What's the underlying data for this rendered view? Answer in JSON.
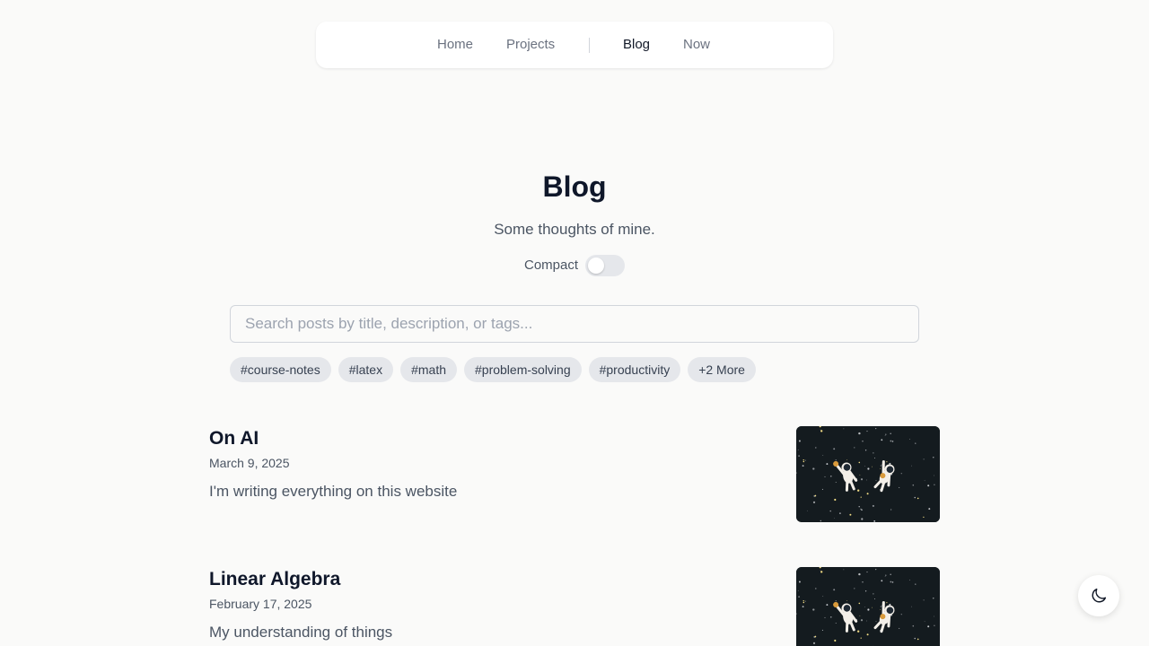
{
  "nav": {
    "items": [
      {
        "label": "Home",
        "active": false
      },
      {
        "label": "Projects",
        "active": false
      },
      {
        "label": "Blog",
        "active": true
      },
      {
        "label": "Now",
        "active": false
      }
    ]
  },
  "header": {
    "title": "Blog",
    "subtitle": "Some thoughts of mine.",
    "compact_label": "Compact",
    "compact_enabled": false
  },
  "search": {
    "value": "",
    "placeholder": "Search posts by title, description, or tags..."
  },
  "tags": [
    "#course-notes",
    "#latex",
    "#math",
    "#problem-solving",
    "#productivity",
    "+2 More"
  ],
  "posts": [
    {
      "title": "On AI",
      "date": "March 9, 2025",
      "description": "I'm writing everything on this website",
      "thumbnail_icon": "astronauts-in-space-image"
    },
    {
      "title": "Linear Algebra",
      "date": "February 17, 2025",
      "description": "My understanding of things",
      "thumbnail_icon": "astronauts-in-space-image"
    }
  ],
  "theme_toggle": {
    "icon": "moon-icon"
  }
}
